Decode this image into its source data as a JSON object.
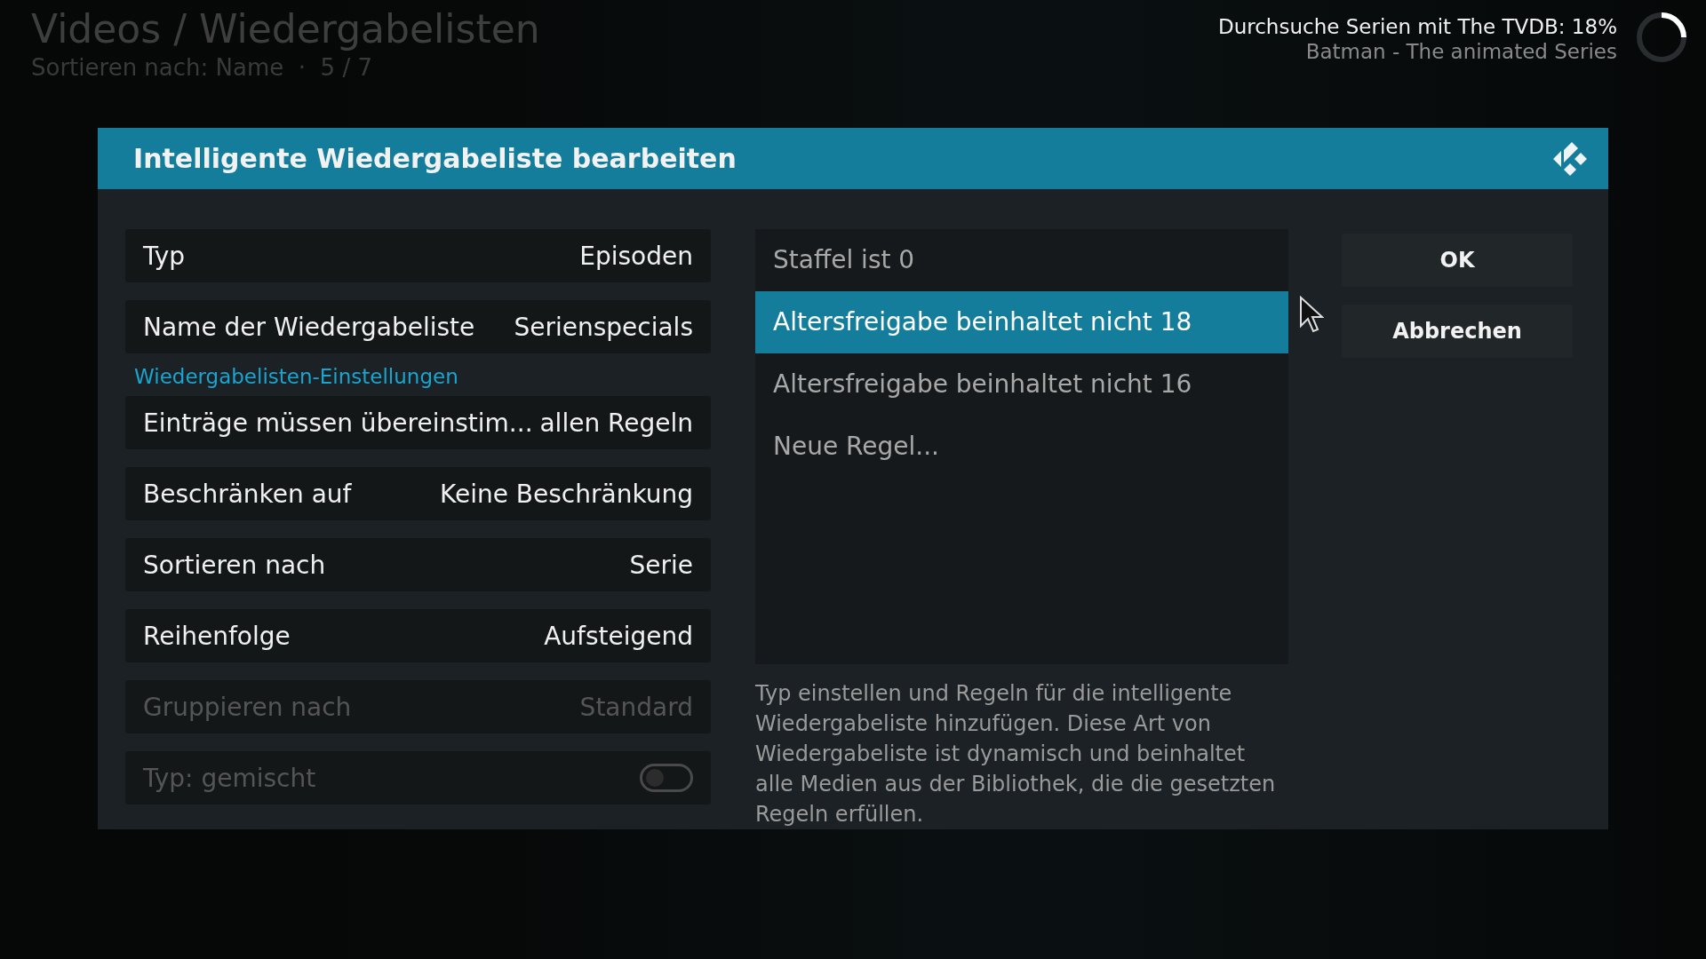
{
  "header": {
    "title": "Videos / Wiedergabelisten",
    "subtitle": "Sortieren nach: Name  ·  5 / 7"
  },
  "progress": {
    "title": "Durchsuche Serien mit The TVDB: 18%",
    "item": "Batman - The animated Series"
  },
  "dialog": {
    "title": "Intelligente Wiedergabeliste bearbeiten",
    "settings": [
      {
        "kind": "value",
        "label": "Typ",
        "value": "Episoden",
        "disabled": false
      },
      {
        "kind": "value",
        "label": "Name der Wiedergabeliste",
        "value": "Serienspecials",
        "disabled": false
      },
      {
        "kind": "section",
        "label": "Wiedergabelisten-Einstellungen"
      },
      {
        "kind": "value",
        "label": "Einträge müssen übereinstim...",
        "value": "allen Regeln",
        "disabled": false
      },
      {
        "kind": "value",
        "label": "Beschränken auf",
        "value": "Keine Beschränkung",
        "disabled": false
      },
      {
        "kind": "value",
        "label": "Sortieren nach",
        "value": "Serie",
        "disabled": false
      },
      {
        "kind": "value",
        "label": "Reihenfolge",
        "value": "Aufsteigend",
        "disabled": false
      },
      {
        "kind": "value",
        "label": "Gruppieren nach",
        "value": "Standard",
        "disabled": true
      },
      {
        "kind": "toggle",
        "label": "Typ: gemischt",
        "on": false,
        "disabled": true
      }
    ],
    "rules": [
      {
        "label": "Staffel ist 0",
        "selected": false
      },
      {
        "label": "Altersfreigabe beinhaltet nicht 18",
        "selected": true
      },
      {
        "label": "Altersfreigabe beinhaltet nicht 16",
        "selected": false
      },
      {
        "label": "Neue Regel...",
        "selected": false
      }
    ],
    "description": "Typ einstellen und Regeln für die intelligente Wiedergabeliste hinzufügen. Diese Art von Wiedergabeliste ist dynamisch und beinhaltet alle Medien aus der Bibliothek, die die gesetzten Regeln erfüllen.",
    "buttons": [
      "OK",
      "Abbrechen"
    ]
  }
}
